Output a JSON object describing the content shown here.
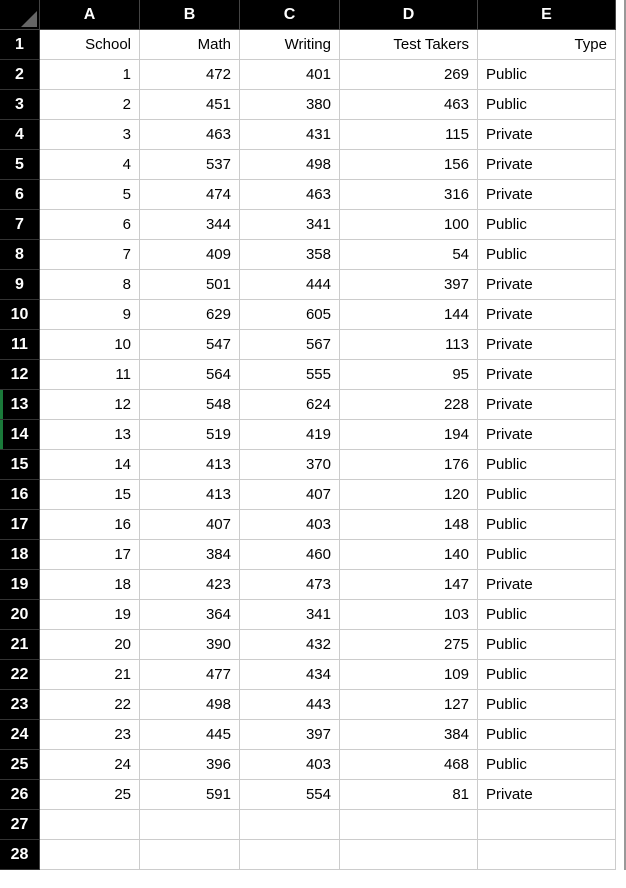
{
  "columns": [
    "A",
    "B",
    "C",
    "D",
    "E"
  ],
  "row_headers": [
    "1",
    "2",
    "3",
    "4",
    "5",
    "6",
    "7",
    "8",
    "9",
    "10",
    "11",
    "12",
    "13",
    "14",
    "15",
    "16",
    "17",
    "18",
    "19",
    "20",
    "21",
    "22",
    "23",
    "24",
    "25",
    "26",
    "27",
    "28"
  ],
  "marked_rows": [
    13,
    14
  ],
  "header_row": {
    "A": "School",
    "B": "Math",
    "C": "Writing",
    "D": "Test Takers",
    "E": "Type"
  },
  "data_rows": [
    {
      "A": "1",
      "B": "472",
      "C": "401",
      "D": "269",
      "E": "Public"
    },
    {
      "A": "2",
      "B": "451",
      "C": "380",
      "D": "463",
      "E": "Public"
    },
    {
      "A": "3",
      "B": "463",
      "C": "431",
      "D": "115",
      "E": "Private"
    },
    {
      "A": "4",
      "B": "537",
      "C": "498",
      "D": "156",
      "E": "Private"
    },
    {
      "A": "5",
      "B": "474",
      "C": "463",
      "D": "316",
      "E": "Private"
    },
    {
      "A": "6",
      "B": "344",
      "C": "341",
      "D": "100",
      "E": "Public"
    },
    {
      "A": "7",
      "B": "409",
      "C": "358",
      "D": "54",
      "E": "Public"
    },
    {
      "A": "8",
      "B": "501",
      "C": "444",
      "D": "397",
      "E": "Private"
    },
    {
      "A": "9",
      "B": "629",
      "C": "605",
      "D": "144",
      "E": "Private"
    },
    {
      "A": "10",
      "B": "547",
      "C": "567",
      "D": "113",
      "E": "Private"
    },
    {
      "A": "11",
      "B": "564",
      "C": "555",
      "D": "95",
      "E": "Private"
    },
    {
      "A": "12",
      "B": "548",
      "C": "624",
      "D": "228",
      "E": "Private"
    },
    {
      "A": "13",
      "B": "519",
      "C": "419",
      "D": "194",
      "E": "Private"
    },
    {
      "A": "14",
      "B": "413",
      "C": "370",
      "D": "176",
      "E": "Public"
    },
    {
      "A": "15",
      "B": "413",
      "C": "407",
      "D": "120",
      "E": "Public"
    },
    {
      "A": "16",
      "B": "407",
      "C": "403",
      "D": "148",
      "E": "Public"
    },
    {
      "A": "17",
      "B": "384",
      "C": "460",
      "D": "140",
      "E": "Public"
    },
    {
      "A": "18",
      "B": "423",
      "C": "473",
      "D": "147",
      "E": "Private"
    },
    {
      "A": "19",
      "B": "364",
      "C": "341",
      "D": "103",
      "E": "Public"
    },
    {
      "A": "20",
      "B": "390",
      "C": "432",
      "D": "275",
      "E": "Public"
    },
    {
      "A": "21",
      "B": "477",
      "C": "434",
      "D": "109",
      "E": "Public"
    },
    {
      "A": "22",
      "B": "498",
      "C": "443",
      "D": "127",
      "E": "Public"
    },
    {
      "A": "23",
      "B": "445",
      "C": "397",
      "D": "384",
      "E": "Public"
    },
    {
      "A": "24",
      "B": "396",
      "C": "403",
      "D": "468",
      "E": "Public"
    },
    {
      "A": "25",
      "B": "591",
      "C": "554",
      "D": "81",
      "E": "Private"
    }
  ],
  "chart_data": {
    "type": "table",
    "title": "",
    "columns": [
      "School",
      "Math",
      "Writing",
      "Test Takers",
      "Type"
    ],
    "rows": [
      [
        1,
        472,
        401,
        269,
        "Public"
      ],
      [
        2,
        451,
        380,
        463,
        "Public"
      ],
      [
        3,
        463,
        431,
        115,
        "Private"
      ],
      [
        4,
        537,
        498,
        156,
        "Private"
      ],
      [
        5,
        474,
        463,
        316,
        "Private"
      ],
      [
        6,
        344,
        341,
        100,
        "Public"
      ],
      [
        7,
        409,
        358,
        54,
        "Public"
      ],
      [
        8,
        501,
        444,
        397,
        "Private"
      ],
      [
        9,
        629,
        605,
        144,
        "Private"
      ],
      [
        10,
        547,
        567,
        113,
        "Private"
      ],
      [
        11,
        564,
        555,
        95,
        "Private"
      ],
      [
        12,
        548,
        624,
        228,
        "Private"
      ],
      [
        13,
        519,
        419,
        194,
        "Private"
      ],
      [
        14,
        413,
        370,
        176,
        "Public"
      ],
      [
        15,
        413,
        407,
        120,
        "Public"
      ],
      [
        16,
        407,
        403,
        148,
        "Public"
      ],
      [
        17,
        384,
        460,
        140,
        "Public"
      ],
      [
        18,
        423,
        473,
        147,
        "Private"
      ],
      [
        19,
        364,
        341,
        103,
        "Public"
      ],
      [
        20,
        390,
        432,
        275,
        "Public"
      ],
      [
        21,
        477,
        434,
        109,
        "Public"
      ],
      [
        22,
        498,
        443,
        127,
        "Public"
      ],
      [
        23,
        445,
        397,
        384,
        "Public"
      ],
      [
        24,
        396,
        403,
        468,
        "Public"
      ],
      [
        25,
        591,
        554,
        81,
        "Private"
      ]
    ]
  }
}
